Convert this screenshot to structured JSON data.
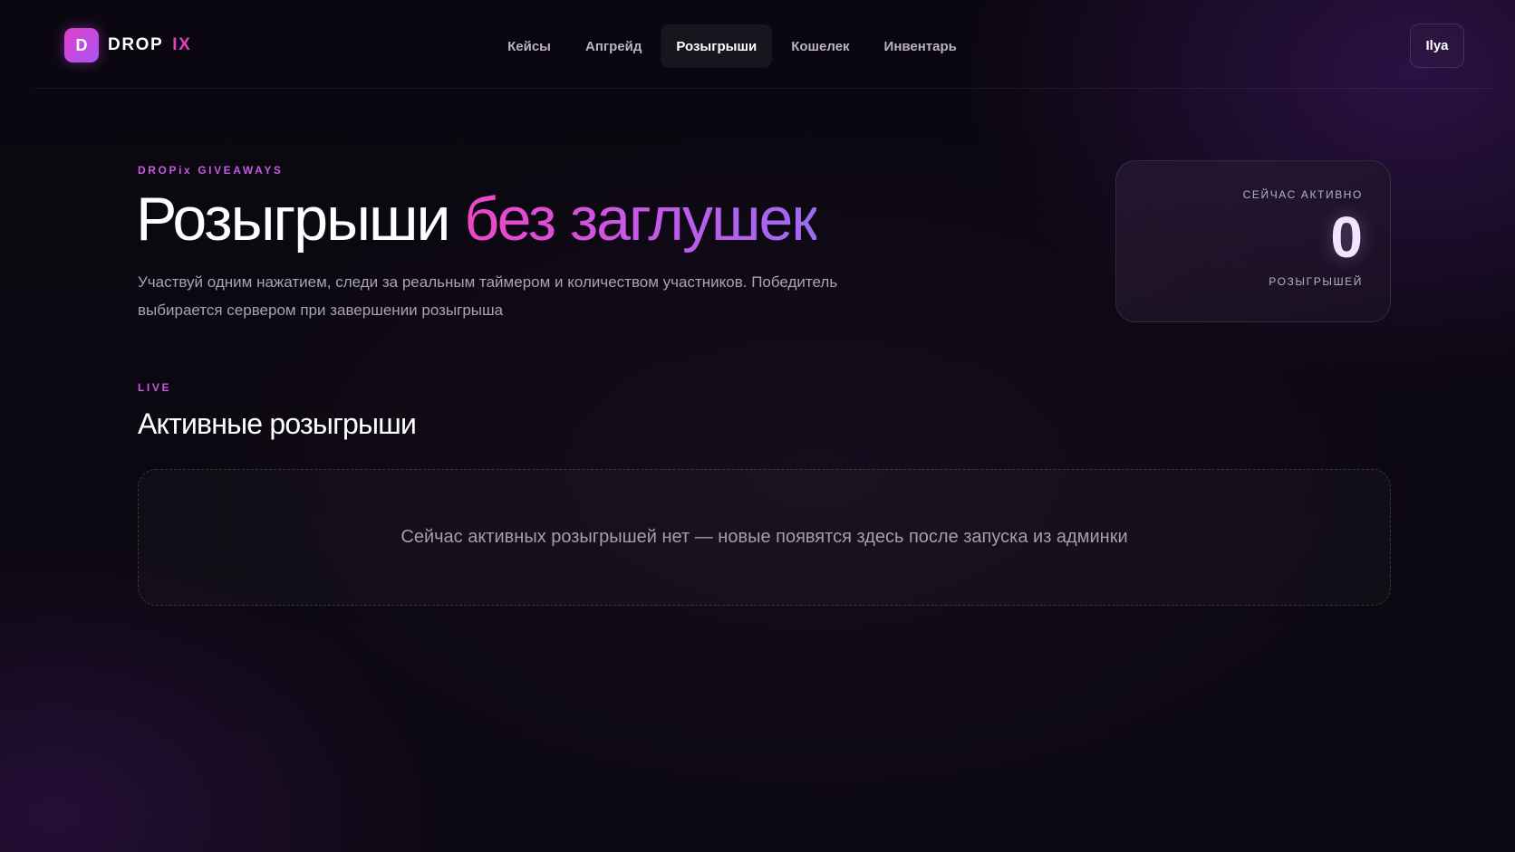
{
  "header": {
    "logo_mark": "D",
    "logo_word1": "DROP",
    "logo_word2": "IX",
    "nav": [
      {
        "label": "Кейсы",
        "active": false
      },
      {
        "label": "Апгрейд",
        "active": false
      },
      {
        "label": "Розыгрыши",
        "active": true
      },
      {
        "label": "Кошелек",
        "active": false
      },
      {
        "label": "Инвентарь",
        "active": false
      }
    ],
    "user_label": "Ilya"
  },
  "hero": {
    "eyebrow": "DROPix GIVEAWAYS",
    "title_plain": "Розыгрыши",
    "title_accent": "без заглушек",
    "description": "Участвуй одним нажатием, следи за реальным таймером и количеством участников. Победитель выбирается сервером при завершении розыгрыша"
  },
  "stat": {
    "label": "СЕЙЧАС АКТИВНО",
    "value": "0",
    "sublabel": "РОЗЫГРЫШЕЙ"
  },
  "section": {
    "eyebrow": "LIVE",
    "title": "Активные розыгрыши",
    "empty_message": "Сейчас активных розыгрышей нет — новые появятся здесь после запуска из админки"
  },
  "colors": {
    "accent": "#e23ec6",
    "accent_purple": "#a855f7",
    "background": "#0b0710"
  }
}
